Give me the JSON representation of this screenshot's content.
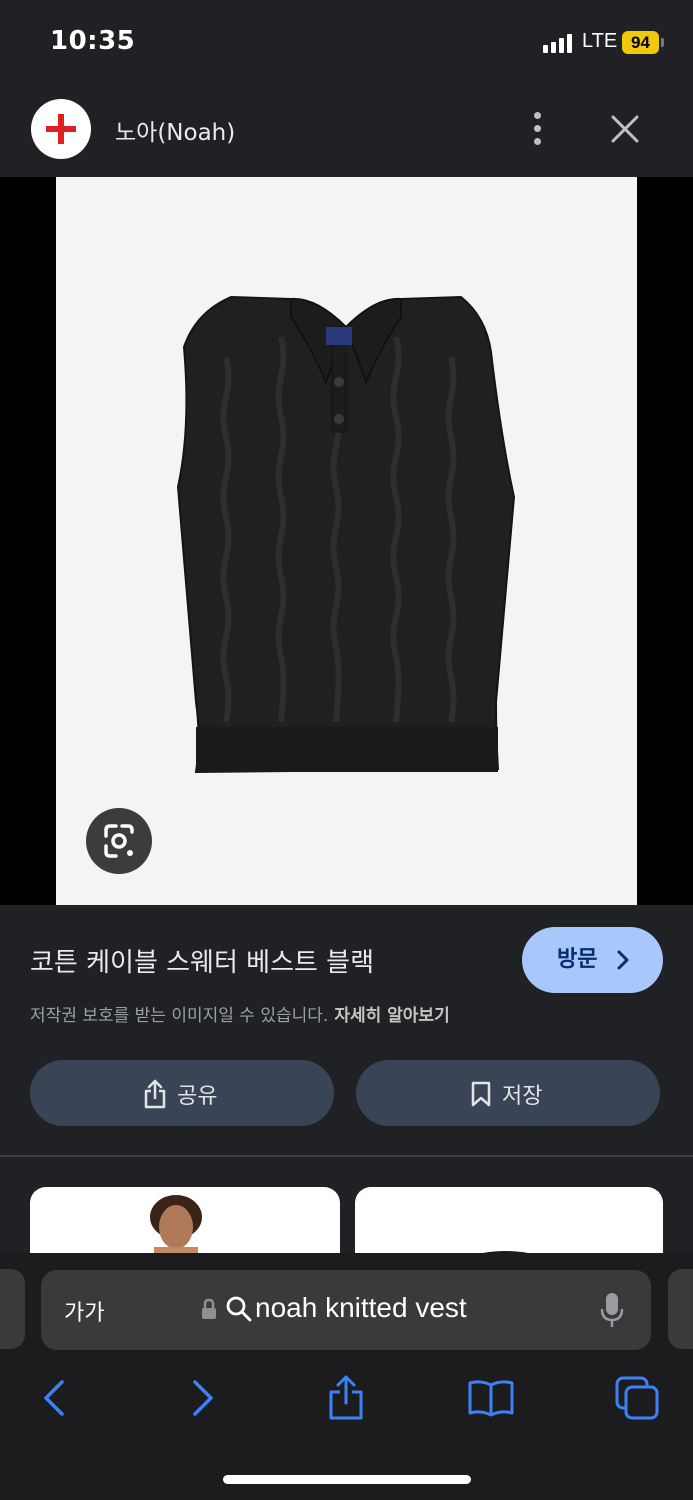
{
  "status_bar": {
    "time": "10:35",
    "network": "LTE",
    "battery": "94"
  },
  "site": {
    "name": "노아(Noah)"
  },
  "product": {
    "image_alt": "black knitted cable polo vest",
    "title": "코튼 케이블 스웨터 베스트 블랙",
    "visit_label": "방문",
    "copyright_note": "저작권 보호를 받는 이미지일 수 있습니다.",
    "learn_more_label": "자세히 알아보기",
    "share_label": "공유",
    "save_label": "저장"
  },
  "address_bar": {
    "text_size_label": "가가",
    "url_text": "noah knitted vest"
  },
  "colors": {
    "background": "#202124",
    "accent_button": "#a8c7fa",
    "secondary_button": "#394457",
    "safari_blue": "#3b82f6"
  }
}
